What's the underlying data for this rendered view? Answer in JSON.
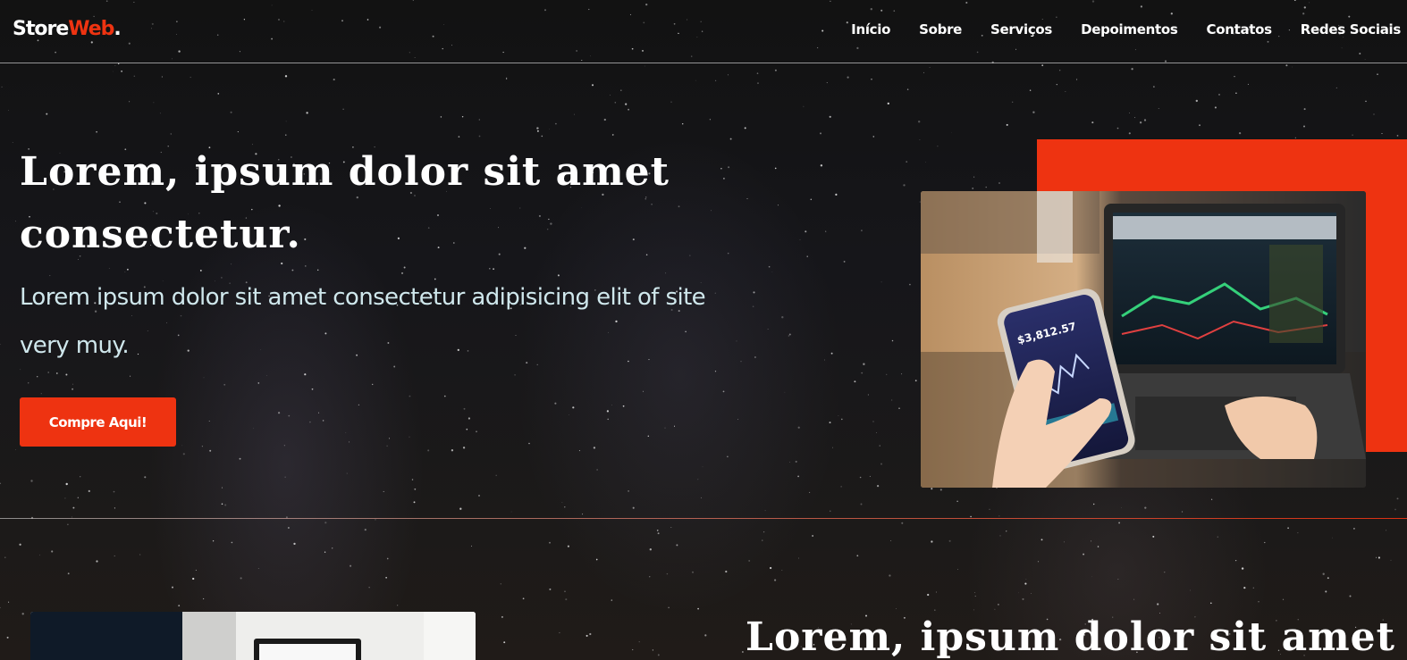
{
  "logo": {
    "brand_main": "Store",
    "brand_accent": "Web",
    "brand_dot": "."
  },
  "nav": {
    "items": [
      {
        "label": "Início"
      },
      {
        "label": "Sobre"
      },
      {
        "label": "Serviços"
      },
      {
        "label": "Depoimentos"
      },
      {
        "label": "Contatos"
      },
      {
        "label": "Redes Sociais"
      }
    ]
  },
  "hero": {
    "title": "Lorem, ipsum dolor sit amet consectetur.",
    "subtitle": "Lorem ipsum dolor sit amet consectetur adipisicing elit of site very muy.",
    "cta_label": "Compre Aqui!"
  },
  "phone_screen": {
    "value": "$3,812.57"
  },
  "section2": {
    "title": "Lorem, ipsum dolor sit amet"
  },
  "colors": {
    "accent": "#ee3311",
    "text": "#ffffff",
    "subtitle": "#cfe7ec",
    "background": "#14130f"
  }
}
